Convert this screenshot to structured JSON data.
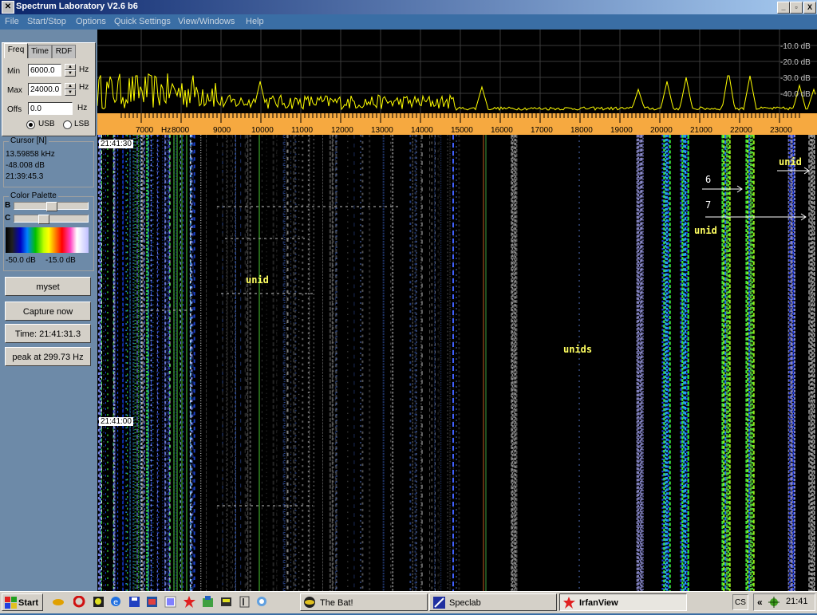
{
  "window": {
    "title": "Spectrum Laboratory V2.6 b6",
    "minimize": "_",
    "maximize": "▫",
    "close": "X"
  },
  "menu": [
    "File",
    "Start/Stop",
    "Options",
    "Quick Settings",
    "View/Windows",
    "Help"
  ],
  "tabs": [
    "Freq",
    "Time",
    "RDF"
  ],
  "freq": {
    "min_label": "Min",
    "min_value": "6000.0",
    "min_unit": "Hz",
    "max_label": "Max",
    "max_value": "24000.0",
    "max_unit": "Hz",
    "offs_label": "Offs",
    "offs_value": "0.0",
    "offs_unit": "Hz",
    "usb_label": "USB",
    "lsb_label": "LSB"
  },
  "cursor": {
    "title": "Cursor [N]",
    "freq": "13.59858 kHz",
    "level": "-48.008 dB",
    "time": "21:39:45.3"
  },
  "palette": {
    "title": "Color Palette",
    "b_label": "B",
    "c_label": "C",
    "low": "-50.0 dB",
    "high": "-15.0 dB"
  },
  "buttons": {
    "myset": "myset",
    "capture": "Capture now",
    "time": "Time:  21:41:31.3",
    "peak": "peak at 299.73 Hz"
  },
  "db_scale": [
    "-10.0 dB",
    "-20.0 dB",
    "-30.0 dB",
    "-40.0 dB"
  ],
  "freq_axis": {
    "unit": "Hz",
    "labels": [
      "7000",
      "8000",
      "9000",
      "10000",
      "11000",
      "12000",
      "13000",
      "14000",
      "15000",
      "16000",
      "17000",
      "18000",
      "19000",
      "20000",
      "21000",
      "22000",
      "23000"
    ]
  },
  "waterfall": {
    "time_labels": [
      "21:41:30",
      "21:41:00"
    ],
    "annotations": {
      "unid1": "unid",
      "unids": "unids",
      "unid2": "unid",
      "unid3": "unid",
      "n6": "6",
      "n7": "7"
    }
  },
  "taskbar": {
    "start": "Start",
    "tasks": [
      "The Bat!",
      "Speclab",
      "IrfanView"
    ],
    "lang": "CS",
    "tray_expand": "«",
    "clock": "21:41"
  },
  "colors": {
    "accent": "#0a246a",
    "spectrum_trace": "#ffff00",
    "axis_bg": "#f6a940"
  }
}
